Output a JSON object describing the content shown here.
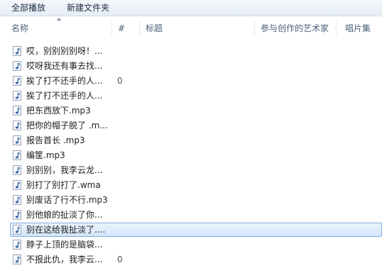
{
  "toolbar": {
    "play_all": "全部播放",
    "new_folder": "新建文件夹"
  },
  "columns": {
    "name": "名称",
    "number": "#",
    "title": "标题",
    "artist": "参与创作的艺术家",
    "album": "唱片集"
  },
  "files": [
    {
      "name": "哎，别别别别呀！...",
      "number": ""
    },
    {
      "name": "哎呀我还有事去找...",
      "number": ""
    },
    {
      "name": "挨了打不还手的人...",
      "number": "0"
    },
    {
      "name": "挨了打不还手的人...",
      "number": ""
    },
    {
      "name": "把东西放下.mp3",
      "number": ""
    },
    {
      "name": "把你的帽子脱了 .m...",
      "number": ""
    },
    {
      "name": "报告首长 .mp3",
      "number": ""
    },
    {
      "name": "编筐.mp3",
      "number": ""
    },
    {
      "name": "别别别，我李云龙...",
      "number": ""
    },
    {
      "name": "别打了别打了.wma",
      "number": ""
    },
    {
      "name": "别废话了行不行.mp3",
      "number": ""
    },
    {
      "name": "别他娘的扯淡了你...",
      "number": ""
    },
    {
      "name": "别在这给我扯淡了....",
      "number": "",
      "selected": true
    },
    {
      "name": "脖子上顶的是脑袋...",
      "number": ""
    },
    {
      "name": "不报此仇，我李云...",
      "number": "0"
    }
  ],
  "icons": {
    "file": "audio-file-icon"
  }
}
